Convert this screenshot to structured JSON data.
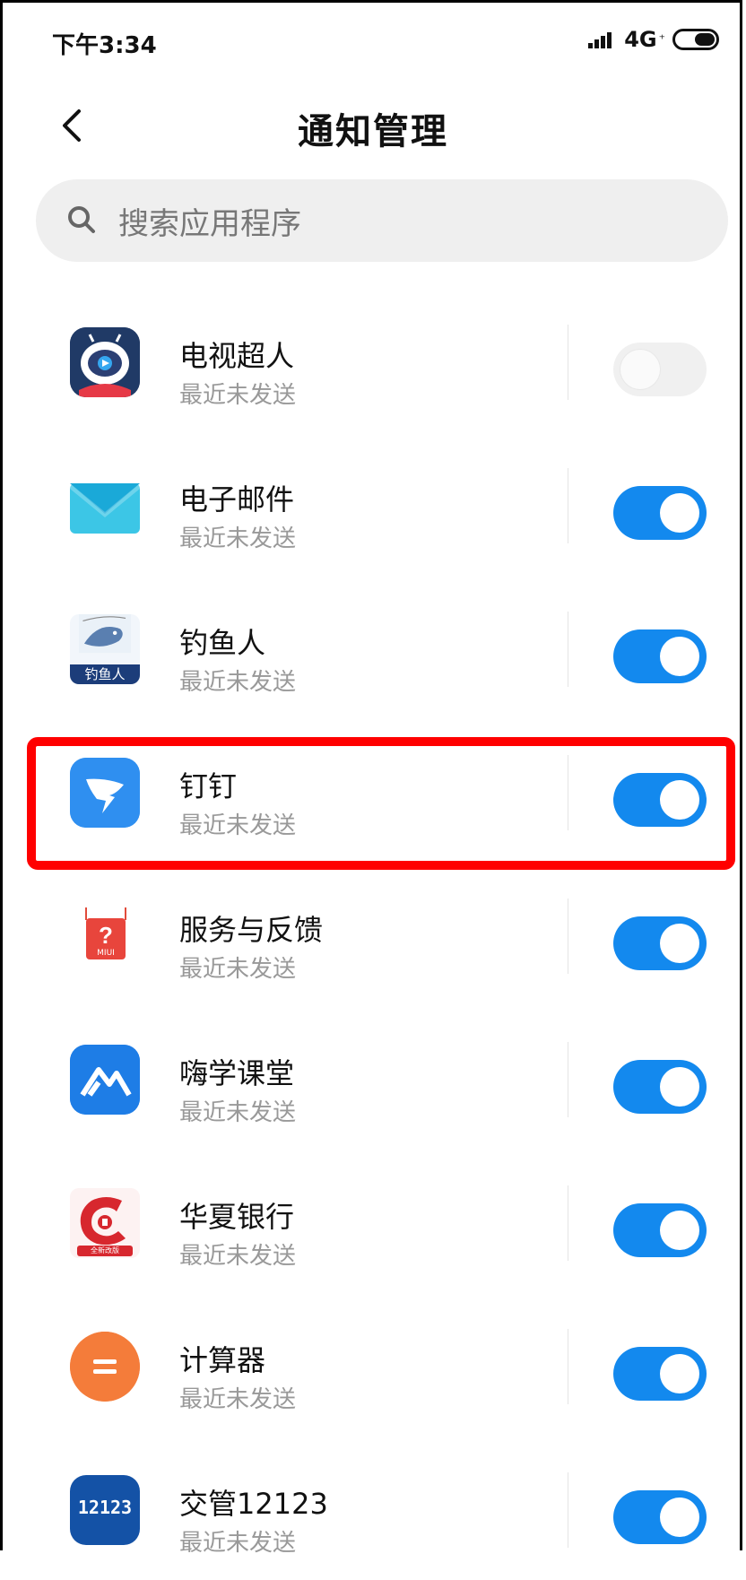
{
  "status_bar": {
    "time": "下午3:34",
    "network": "4G",
    "network_sup": "⁺"
  },
  "header": {
    "title": "通知管理"
  },
  "search": {
    "placeholder": "搜索应用程序"
  },
  "apps": [
    {
      "name": "电视超人",
      "status": "最近未发送",
      "enabled": false,
      "icon": "tv-superman-app-icon"
    },
    {
      "name": "电子邮件",
      "status": "最近未发送",
      "enabled": true,
      "icon": "email-app-icon"
    },
    {
      "name": "钓鱼人",
      "status": "最近未发送",
      "enabled": true,
      "icon": "fisherman-app-icon",
      "icon_text": "钓鱼人"
    },
    {
      "name": "钉钉",
      "status": "最近未发送",
      "enabled": true,
      "icon": "dingtalk-app-icon"
    },
    {
      "name": "服务与反馈",
      "status": "最近未发送",
      "enabled": true,
      "icon": "service-feedback-app-icon",
      "icon_text": "MIUI"
    },
    {
      "name": "嗨学课堂",
      "status": "最近未发送",
      "enabled": true,
      "icon": "haixue-app-icon"
    },
    {
      "name": "华夏银行",
      "status": "最近未发送",
      "enabled": true,
      "icon": "huaxia-bank-app-icon",
      "icon_text": "全新改版"
    },
    {
      "name": "计算器",
      "status": "最近未发送",
      "enabled": true,
      "icon": "calculator-app-icon"
    },
    {
      "name": "交管12123",
      "status": "最近未发送",
      "enabled": true,
      "icon": "jiaoguan-12123-app-icon",
      "icon_text": "12123"
    }
  ],
  "colors": {
    "toggle_on": "#1389ee",
    "highlight": "#ff0000"
  }
}
